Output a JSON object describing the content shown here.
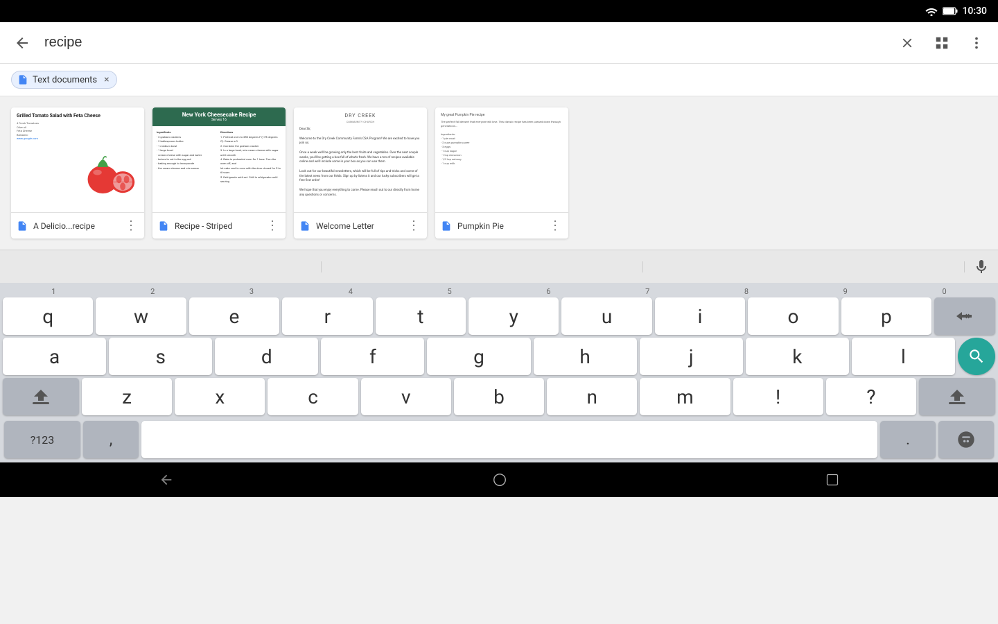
{
  "statusBar": {
    "time": "10:30"
  },
  "searchBar": {
    "query": "recipe",
    "clearLabel": "×",
    "gridLabel": "⊞",
    "moreLabel": "⋮",
    "backLabel": "←"
  },
  "filterRow": {
    "chipLabel": "Text documents",
    "chipClose": "×"
  },
  "results": [
    {
      "id": "doc1",
      "title": "A Delicio...recipe",
      "previewType": "tomato-salad"
    },
    {
      "id": "doc2",
      "title": "Recipe - Striped",
      "previewType": "cheesecake"
    },
    {
      "id": "doc3",
      "title": "Welcome Letter",
      "previewType": "welcome"
    },
    {
      "id": "doc4",
      "title": "Pumpkin Pie",
      "previewType": "pumpkin"
    }
  ],
  "previewDoc1": {
    "heading": "Grilled Tomato Salad with Feta Cheese",
    "subtext": "4 Fresh Tomatoes\nOlive oil\nFeta Cheese\nBalsamic\nwww.google.com"
  },
  "previewDoc2": {
    "header": "New York Cheesecake Recipe",
    "subheader": "Serves 16",
    "col1Title": "Ingredients",
    "col2Title": "Directions"
  },
  "previewDoc3": {
    "title": "DRY CREEK",
    "subtitle": "COMMUNITY CHURCH"
  },
  "previewDoc4": {
    "title": "My great Pumpkin Pie recipe"
  },
  "suggestions": [
    "",
    "",
    ""
  ],
  "keyboard": {
    "row1": [
      "q",
      "w",
      "e",
      "r",
      "t",
      "y",
      "u",
      "i",
      "o",
      "p"
    ],
    "row2": [
      "a",
      "s",
      "d",
      "f",
      "g",
      "h",
      "j",
      "k",
      "l"
    ],
    "row3": [
      "z",
      "x",
      "c",
      "v",
      "b",
      "n",
      "m",
      "!",
      "?"
    ],
    "numbers": [
      "1",
      "2",
      "3",
      "4",
      "5",
      "6",
      "7",
      "8",
      "9",
      "0"
    ],
    "numLabel": "?123",
    "comma": ",",
    "period": ".",
    "spaceLabel": ""
  },
  "navBar": {
    "backIcon": "▽",
    "homeIcon": "○",
    "recentIcon": "□"
  }
}
